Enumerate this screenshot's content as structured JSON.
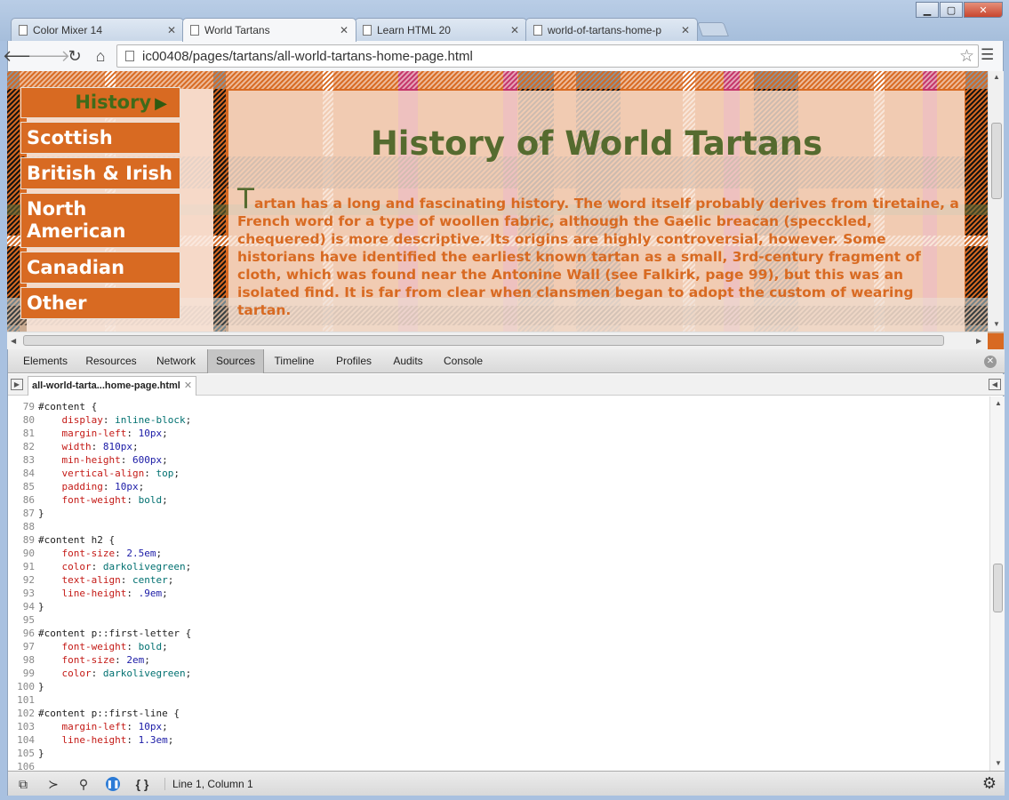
{
  "browser": {
    "tabs": [
      {
        "label": "Color Mixer 14"
      },
      {
        "label": "World Tartans"
      },
      {
        "label": "Learn HTML 20"
      },
      {
        "label": "world-of-tartans-home-p"
      }
    ],
    "url": "ic00408/pages/tartans/all-world-tartans-home-page.html"
  },
  "page": {
    "nav": {
      "history": "History",
      "scottish": "Scottish",
      "british": "British & Irish",
      "north_line1": "North",
      "north_line2": "American",
      "canadian": "Canadian",
      "other": "Other"
    },
    "title": "History of World Tartans",
    "first_letter": "T",
    "paragraph": "artan has a long and fascinating history. The word itself probably derives from tiretaine, a French word for a type of woollen fabric, although the Gaelic breacan (specckled, chequered) is more descriptive. Its origins are highly controversial, however. Some historians have identified the earliest known tartan as a small, 3rd-century fragment of cloth, which was found near the Antonine Wall (see Falkirk, page 99), but this was an isolated find. It is far from clear when clansmen began to adopt the custom of wearing tartan."
  },
  "devtools": {
    "tabs": [
      "Elements",
      "Resources",
      "Network",
      "Sources",
      "Timeline",
      "Profiles",
      "Audits",
      "Console"
    ],
    "active_tab": "Sources",
    "open_file": "all-world-tarta...home-page.html",
    "status": "Line 1, Column 1",
    "code": [
      {
        "n": "79",
        "t": "#content {"
      },
      {
        "n": "80",
        "p": "display",
        "v": "inline-block",
        "vk": "kw"
      },
      {
        "n": "81",
        "p": "margin-left",
        "v": "10px",
        "vk": "val"
      },
      {
        "n": "82",
        "p": "width",
        "v": "810px",
        "vk": "val"
      },
      {
        "n": "83",
        "p": "min-height",
        "v": "600px",
        "vk": "val"
      },
      {
        "n": "84",
        "p": "vertical-align",
        "v": "top",
        "vk": "kw"
      },
      {
        "n": "85",
        "p": "padding",
        "v": "10px",
        "vk": "val"
      },
      {
        "n": "86",
        "p": "font-weight",
        "v": "bold",
        "vk": "kw"
      },
      {
        "n": "87",
        "t": "}"
      },
      {
        "n": "88",
        "t": ""
      },
      {
        "n": "89",
        "t": "#content h2 {"
      },
      {
        "n": "90",
        "p": "font-size",
        "v": "2.5em",
        "vk": "val"
      },
      {
        "n": "91",
        "p": "color",
        "v": "darkolivegreen",
        "vk": "kw"
      },
      {
        "n": "92",
        "p": "text-align",
        "v": "center",
        "vk": "kw"
      },
      {
        "n": "93",
        "p": "line-height",
        "v": ".9em",
        "vk": "val"
      },
      {
        "n": "94",
        "t": "}"
      },
      {
        "n": "95",
        "t": ""
      },
      {
        "n": "96",
        "t": "#content p::first-letter {"
      },
      {
        "n": "97",
        "p": "font-weight",
        "v": "bold",
        "vk": "kw"
      },
      {
        "n": "98",
        "p": "font-size",
        "v": "2em",
        "vk": "val"
      },
      {
        "n": "99",
        "p": "color",
        "v": "darkolivegreen",
        "vk": "kw"
      },
      {
        "n": "100",
        "t": "}"
      },
      {
        "n": "101",
        "t": ""
      },
      {
        "n": "102",
        "t": "#content p::first-line {"
      },
      {
        "n": "103",
        "p": "margin-left",
        "v": "10px",
        "vk": "val"
      },
      {
        "n": "104",
        "p": "line-height",
        "v": "1.3em",
        "vk": "val"
      },
      {
        "n": "105",
        "t": "}"
      },
      {
        "n": "106",
        "t": ""
      }
    ]
  },
  "colors": {
    "tartan_orange": "#d86a22",
    "olive_green": "#556b2f",
    "tartan_magenta": "#c0287a",
    "devtools_active_tab": "#c5c5c5"
  },
  "icons": {
    "back": "back-arrow-icon",
    "forward": "forward-arrow-icon",
    "reload": "reload-icon",
    "home": "home-icon",
    "bookmark": "star-icon",
    "menu": "menu-icon",
    "settings": "gear-icon"
  }
}
